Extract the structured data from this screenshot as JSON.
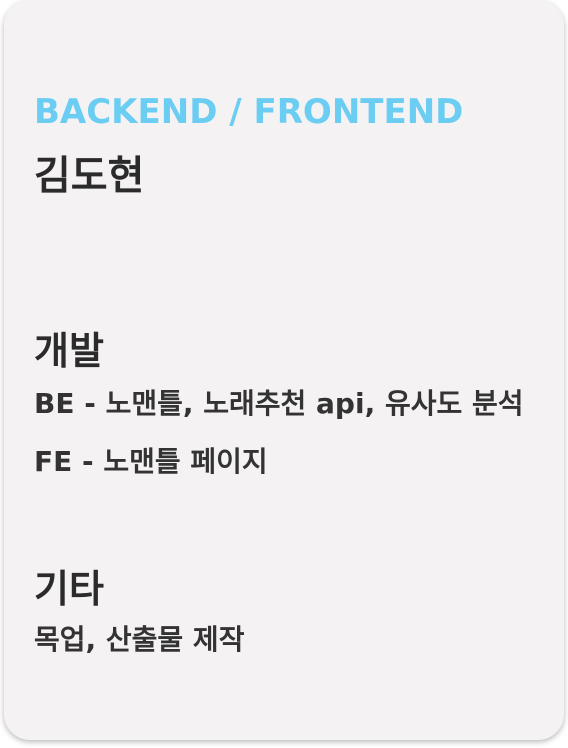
{
  "profile": {
    "role": "BACKEND / FRONTEND",
    "name": "김도현"
  },
  "sections": [
    {
      "title": "개발",
      "items": [
        "BE - 노맨틀, 노래추천 api, 유사도 분석",
        "FE - 노맨틀 페이지"
      ]
    },
    {
      "title": "기타",
      "items": [
        "목업, 산출물 제작"
      ]
    }
  ],
  "colors": {
    "accent": "#6ccdf3",
    "card_background": "#f5f2f3",
    "text": "#2b2b2b"
  }
}
